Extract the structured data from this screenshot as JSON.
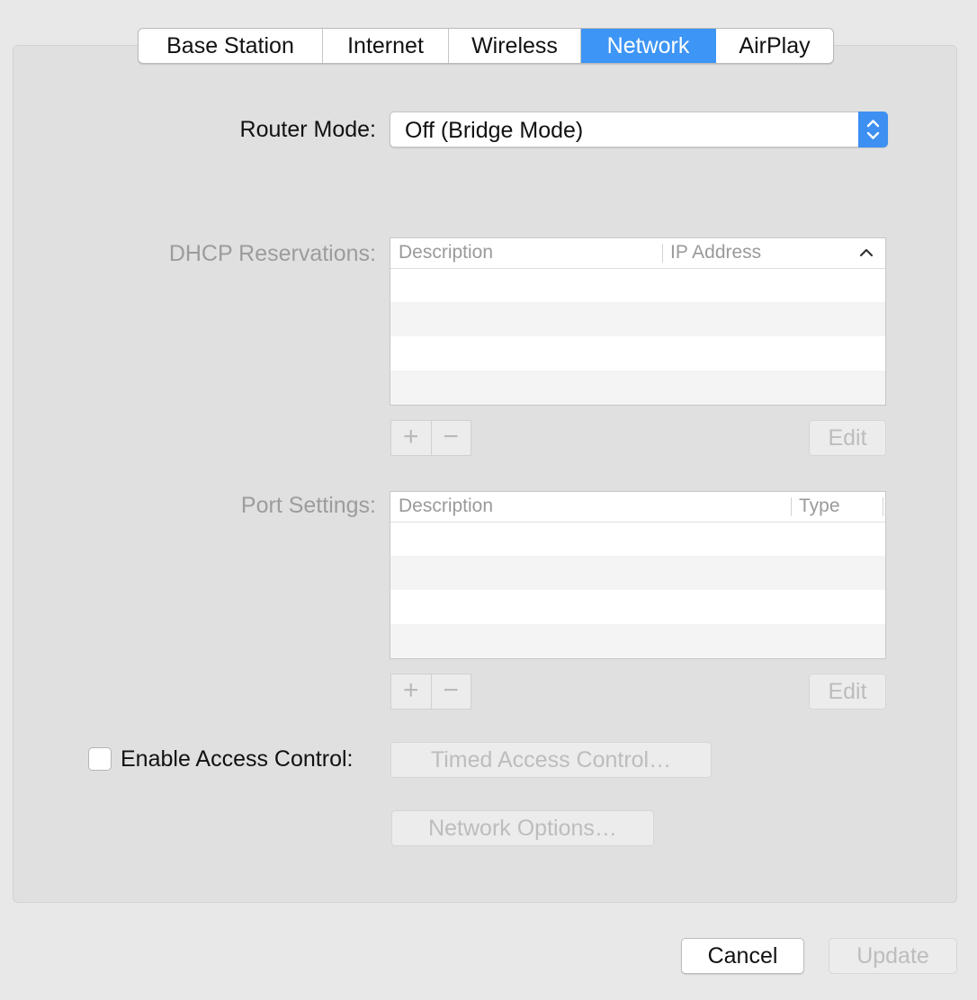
{
  "tabs": [
    "Base Station",
    "Internet",
    "Wireless",
    "Network",
    "AirPlay"
  ],
  "active_tab": "Network",
  "router_mode": {
    "label": "Router Mode:",
    "value": "Off (Bridge Mode)"
  },
  "dhcp": {
    "label": "DHCP Reservations:",
    "columns": [
      "Description",
      "IP Address"
    ],
    "add_label": "+",
    "remove_label": "−",
    "edit_label": "Edit"
  },
  "ports": {
    "label": "Port Settings:",
    "columns": [
      "Description",
      "Type"
    ],
    "add_label": "+",
    "remove_label": "−",
    "edit_label": "Edit"
  },
  "access_control": {
    "label": "Enable Access Control:",
    "checked": false,
    "timed_button": "Timed Access Control…"
  },
  "network_options_button": "Network Options…",
  "footer": {
    "cancel": "Cancel",
    "update": "Update"
  },
  "colors": {
    "accent": "#3d95f5"
  }
}
